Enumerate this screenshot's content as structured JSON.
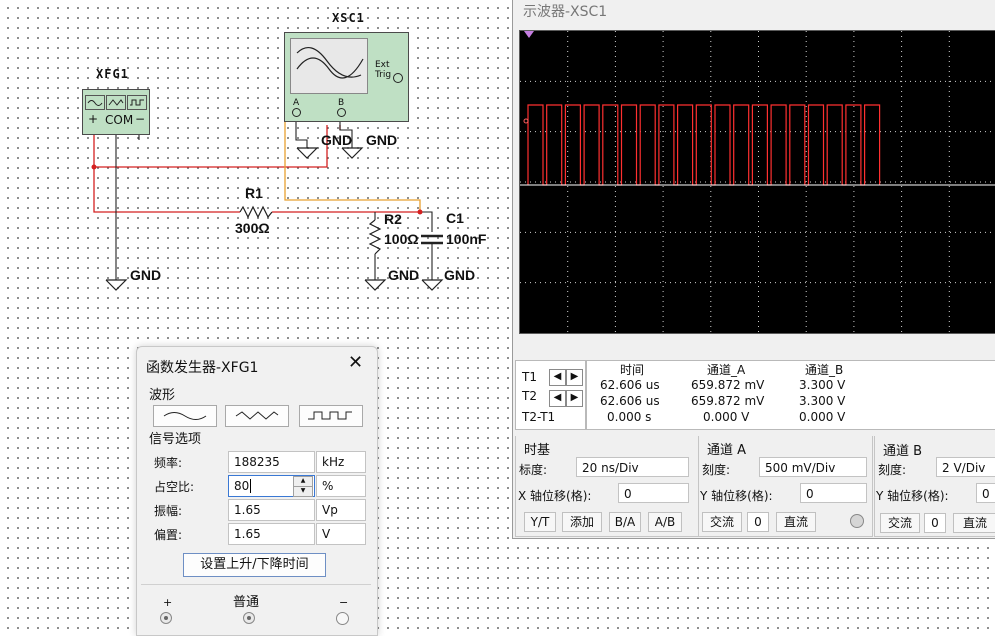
{
  "schematic": {
    "xfg1_label": "XFG1",
    "xfg1_terminals": {
      "plus": "+",
      "com": "COM",
      "minus": "−"
    },
    "xsc1_label": "XSC1",
    "xsc1_ext_trig": "Ext Trig",
    "xsc1_channel_a": "A",
    "xsc1_channel_b": "B",
    "r1_name": "R1",
    "r1_value": "300Ω",
    "r2_name": "R2",
    "r2_value": "100Ω",
    "c1_name": "C1",
    "c1_value": "100nF",
    "gnd": "GND",
    "wire_colors": {
      "red": "#d42020",
      "orange": "#e8a030",
      "black": "#222222"
    }
  },
  "scope": {
    "title": "示波器-XSC1",
    "trace_color": "#ff3030",
    "cursor_table": {
      "headers": [
        "时间",
        "通道_A",
        "通道_B"
      ],
      "rows": [
        {
          "label": "T1",
          "time": "62.606 us",
          "a": "659.872 mV",
          "b": "3.300 V"
        },
        {
          "label": "T2",
          "time": "62.606 us",
          "a": "659.872 mV",
          "b": "3.300 V"
        },
        {
          "label": "T2-T1",
          "time": "0.000 s",
          "a": "0.000 V",
          "b": "0.000 V"
        }
      ]
    },
    "timebase": {
      "title": "时基",
      "scale_label": "标度:",
      "scale_value": "20 ns/Div",
      "xpos_label": "X 轴位移(格):",
      "xpos_value": "0",
      "buttons": [
        "Y/T",
        "添加",
        "B/A",
        "A/B"
      ]
    },
    "channel_a": {
      "title": "通道 A",
      "scale_label": "刻度:",
      "scale_value": "500 mV/Div",
      "ypos_label": "Y 轴位移(格):",
      "ypos_value": "0",
      "ac": "交流",
      "zero": "0",
      "dc": "直流"
    },
    "channel_b": {
      "title": "通道 B",
      "scale_label": "刻度:",
      "scale_value": "2  V/Div",
      "ypos_label": "Y 轴位移(格):",
      "ypos_value": "0",
      "ac": "交流",
      "zero": "0",
      "dc": "直流"
    }
  },
  "function_generator": {
    "title": "函数发生器-XFG1",
    "waveform_section": "波形",
    "signal_section": "信号选项",
    "frequency_label": "频率:",
    "frequency_value": "188235",
    "frequency_unit": "kHz",
    "duty_label": "占空比:",
    "duty_value": "80",
    "duty_unit": "%",
    "amplitude_label": "振幅:",
    "amplitude_value": "1.65",
    "amplitude_unit": "Vp",
    "offset_label": "偏置:",
    "offset_value": "1.65",
    "offset_unit": "V",
    "rise_fall_button": "设置上升/下降时间",
    "terminal_plus": "+",
    "terminal_common": "普通",
    "terminal_minus": "−"
  }
}
